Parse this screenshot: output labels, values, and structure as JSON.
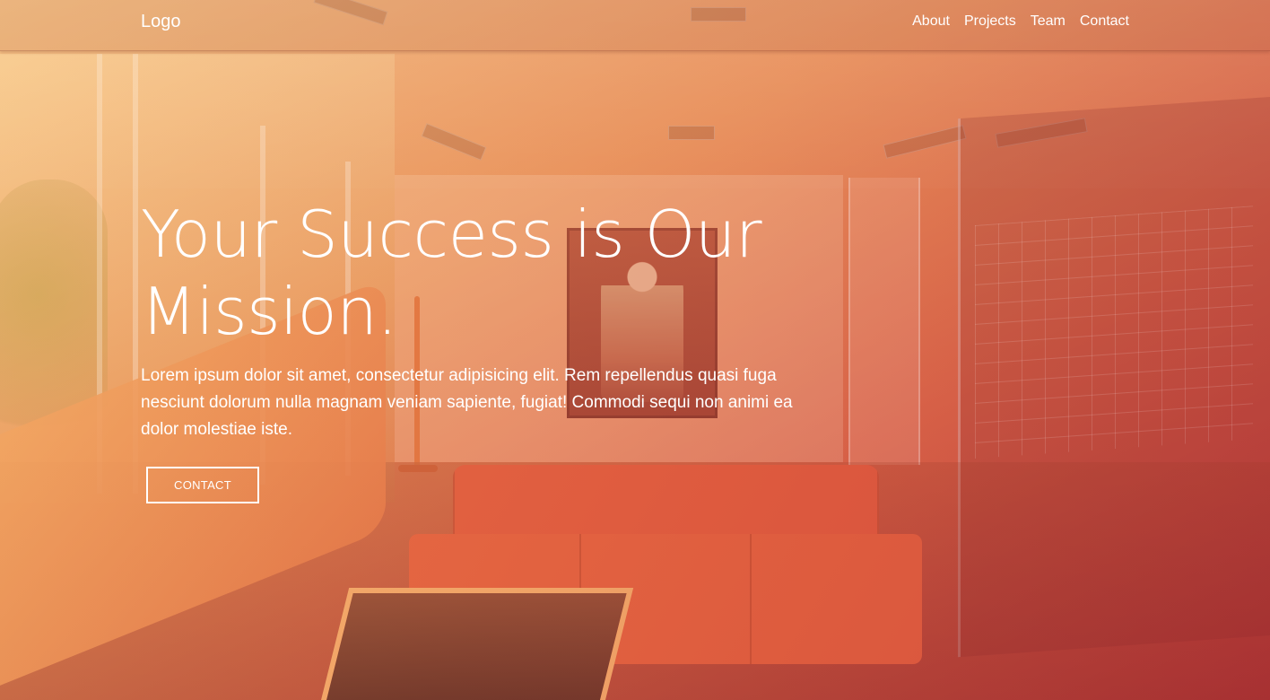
{
  "navbar": {
    "logo": "Logo",
    "links": [
      "About",
      "Projects",
      "Team",
      "Contact"
    ]
  },
  "hero": {
    "headline_line1": "Your Success is Our",
    "headline_line2": "Mission.",
    "lead": "Lorem ipsum dolor sit amet, consectetur adipisicing elit. Rem repellendus quasi fuga nesciunt dolorum nulla magnam veniam sapiente, fugiat! Commodi sequi non animi ea dolor molestiae iste.",
    "cta_label": "CONTACT",
    "background_image": "office-lounge-photo",
    "overlay_gradient": [
      "#f5b872",
      "#e27048",
      "#b0303a"
    ]
  },
  "colors": {
    "text": "#ffffff",
    "button_border": "#ffffff"
  }
}
